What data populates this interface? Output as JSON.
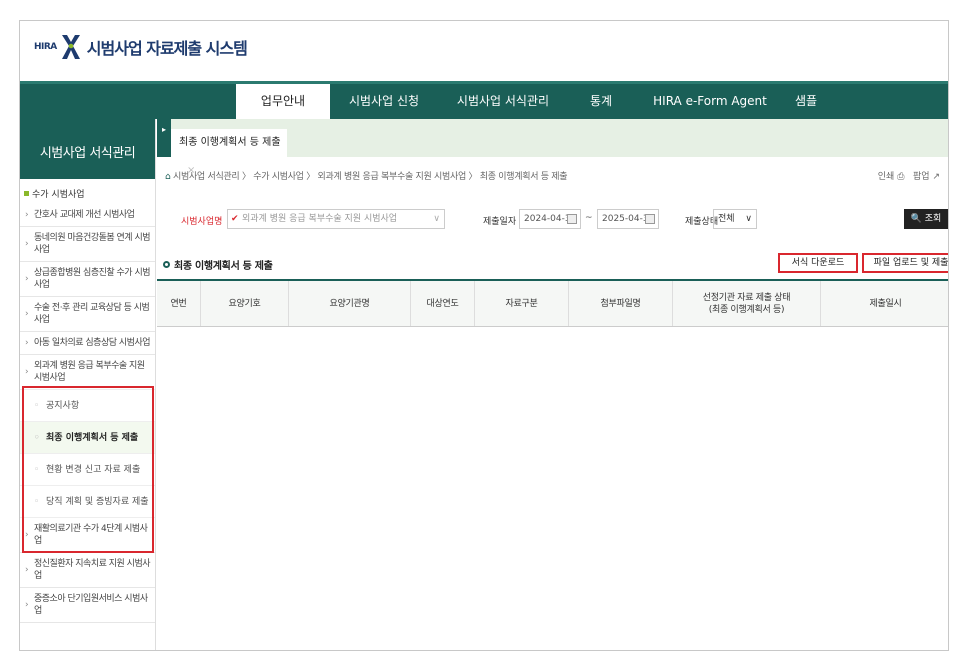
{
  "header": {
    "logo_prefix": "HIRA",
    "title": "시범사업 자료제출 시스템"
  },
  "nav": {
    "items": [
      "업무안내",
      "시범사업 신청",
      "시범사업 서식관리",
      "통계",
      "HIRA e-Form Agent",
      "샘플"
    ]
  },
  "sidebar": {
    "title": "시범사업 서식관리",
    "category": "수가 시범사업",
    "items_top": [
      "간호사 교대제 개선 시범사업",
      "동네의원 마음건강돌봄 연계 시범사업",
      "상급종합병원 심층진찰 수가 시범사업",
      "수술 전·후 관리 교육상담 등 시범사업",
      "아동 일차의료 심층상담 시범사업",
      "외과계 병원 응급 복부수술 지원 시범사업"
    ],
    "sub_items": [
      "공지사항",
      "최종 이행계획서 등 제출",
      "현황 변경 신고 자료 제출",
      "당직 계획 및 증빙자료 제출"
    ],
    "items_bottom": [
      "재활의료기관 수가 4단계 시범사업",
      "정신질환자 지속치료 지원 시범사업",
      "중증소아 단기입원서비스 시범사업"
    ]
  },
  "tab": {
    "label": "최종 이행계획서 등 제출",
    "close": "×",
    "toggle": "▸"
  },
  "breadcrumb": "시범사업 서식관리 〉 수가 시범사업 〉 외과계 병원 응급 복부수술 지원 시범사업 〉 최종 이행계획서 등 제출",
  "util": {
    "print": "인쇄",
    "print_icon": "⎙",
    "popup": "팝업",
    "popup_icon": "↗"
  },
  "search": {
    "biz_label": "시범사업명",
    "biz_value": "외과계 병원 응급 복부수술 지원 시범사업",
    "check_mark": "✔",
    "date_label": "제출일자",
    "date_from": "2024-04-30",
    "tilde": "~",
    "date_to": "2025-04-30",
    "status_label": "제출상태",
    "status_value": "전체",
    "dropdown_arrow": "∨",
    "status_arrow": "∨",
    "search_button": "🔍 조회"
  },
  "section": {
    "title": "최종 이행계획서 등 제출",
    "download_button": "서식 다운로드",
    "upload_button": "파일 업로드 및 제출"
  },
  "table": {
    "columns": [
      "연번",
      "요양기호",
      "요양기관명",
      "대상연도",
      "자료구분",
      "첨부파일명",
      "선정기관 자료 제출 상태\n(최종 이행계획서 등)",
      "제출일시"
    ]
  },
  "colors": {
    "primary": "#1a5f57",
    "highlight_red": "#d9272e",
    "tab_bg": "#e6f0e4"
  }
}
